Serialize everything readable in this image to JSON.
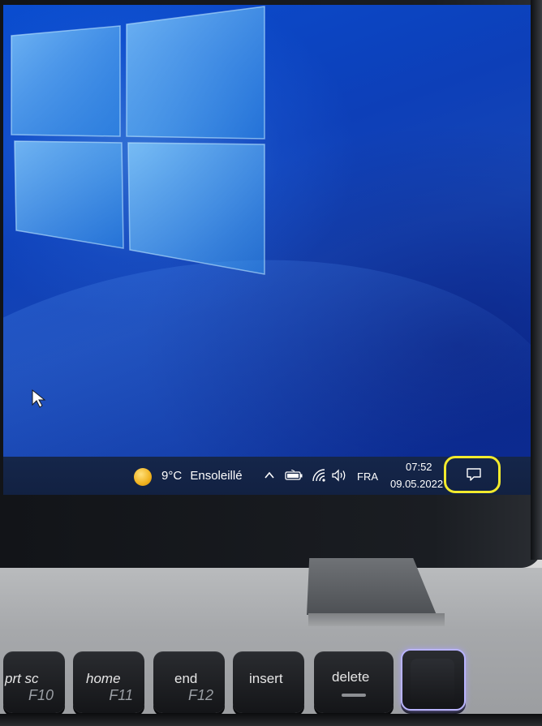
{
  "taskbar": {
    "weather_temp": "9°C",
    "weather_condition": "Ensoleillé",
    "language": "FRA",
    "time": "07:52",
    "date": "09.05.2022"
  },
  "icons": {
    "weather": "sun-icon",
    "tray": "chevron-up-icon",
    "battery": "battery-icon",
    "network": "wifi-icon",
    "volume": "speaker-icon",
    "notifications": "notification-center-icon",
    "cursor": "mouse-cursor-icon",
    "logo": "windows-logo"
  },
  "highlight": {
    "color": "#f2ea2d",
    "target": "notification-center-icon"
  },
  "keyboard": {
    "keys": [
      {
        "label": "prt sc",
        "fn": "F10"
      },
      {
        "label": "home",
        "fn": "F11"
      },
      {
        "label": "end",
        "fn": "F12"
      },
      {
        "label": "insert",
        "fn": ""
      },
      {
        "label": "delete",
        "fn": ""
      }
    ]
  },
  "colors": {
    "desktop": "#0d3fb8",
    "taskbar": "#15264a",
    "power_key_glow": "#b9b4ff"
  }
}
